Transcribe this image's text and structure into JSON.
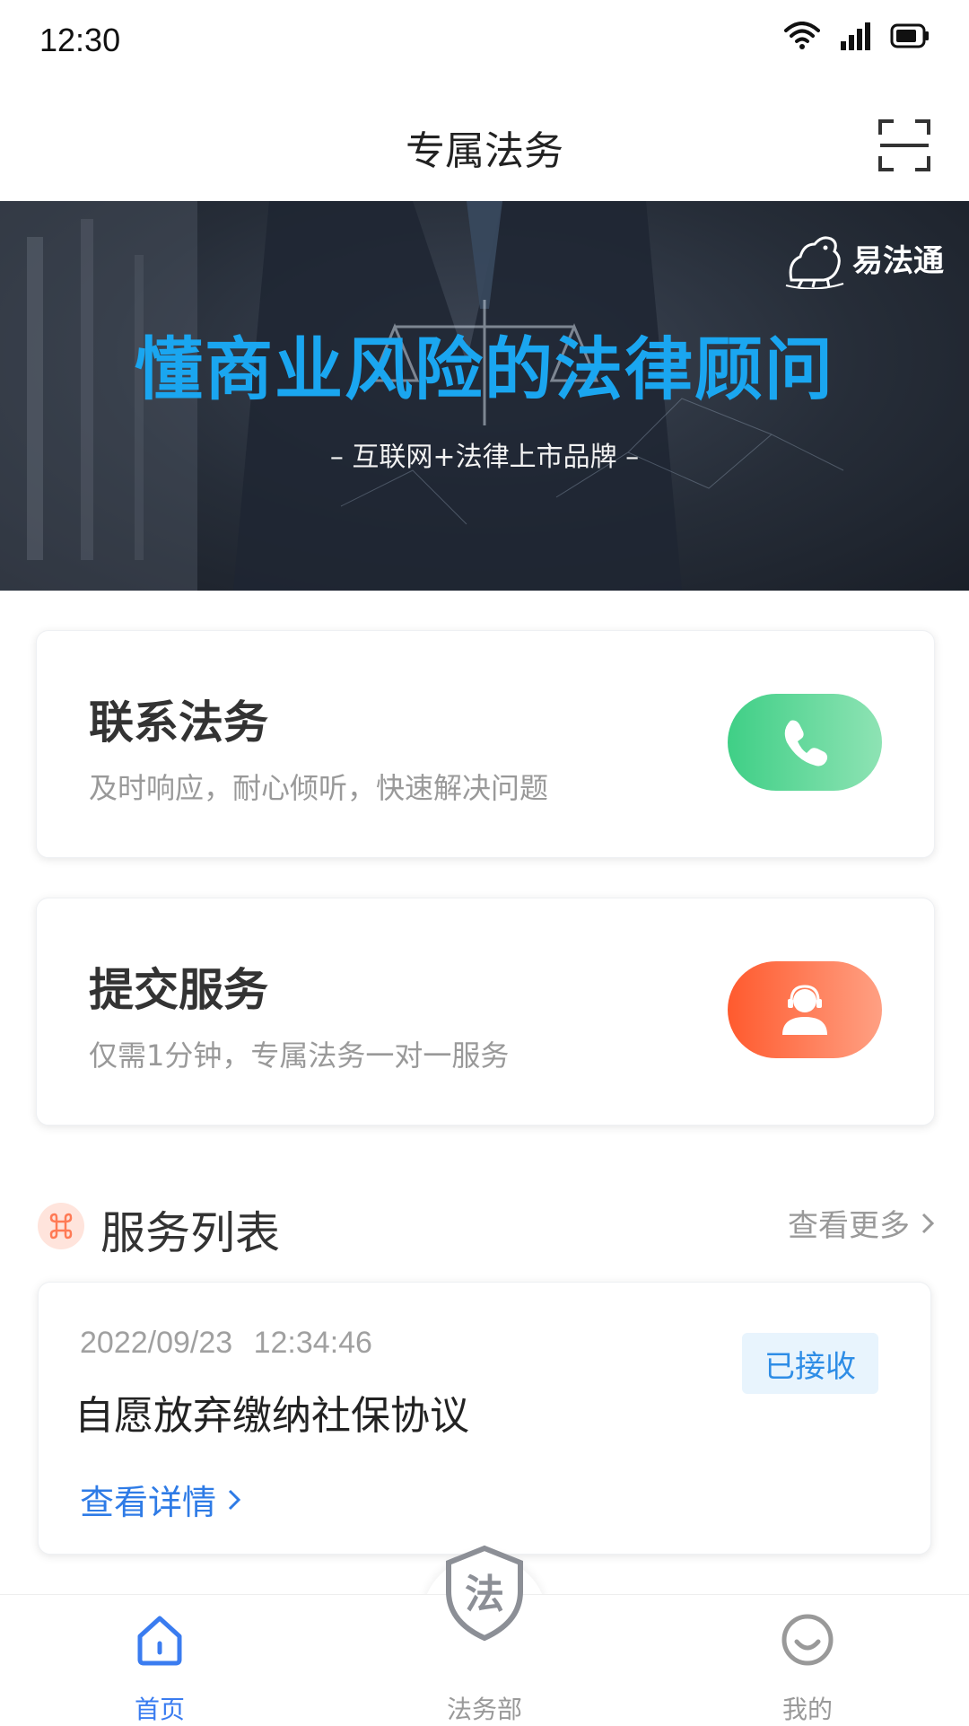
{
  "status_bar": {
    "time": "12:30"
  },
  "nav": {
    "title": "专属法务"
  },
  "banner": {
    "brand": "易法通",
    "headline": "懂商业风险的法律顾问",
    "subtitle": "– 互联网+法律上市品牌 –"
  },
  "cards": [
    {
      "title": "联系法务",
      "desc": "及时响应，耐心倾听，快速解决问题",
      "icon": "phone-icon"
    },
    {
      "title": "提交服务",
      "desc": "仅需1分钟，专属法务一对一服务",
      "icon": "customer-service-icon"
    }
  ],
  "service_list": {
    "title": "服务列表",
    "more_label": "查看更多",
    "items": [
      {
        "time": "2022/09/23 12:34:46",
        "title": "自愿放弃缴纳社保协议",
        "status": "已接收",
        "detail_label": "查看详情"
      }
    ]
  },
  "tabs": [
    {
      "label": "首页",
      "icon": "home-icon",
      "active": true
    },
    {
      "label": "法务部",
      "icon": "legal-shield-icon",
      "glyph": "法",
      "active": false
    },
    {
      "label": "我的",
      "icon": "smile-icon",
      "active": false
    }
  ],
  "colors": {
    "accent_blue": "#2e7be6",
    "headline_blue": "#1aa6f0",
    "call_green": "#3fcf86",
    "submit_orange": "#ff5a2e",
    "tab_active": "#3a7cf0",
    "tab_inactive": "#999999"
  }
}
